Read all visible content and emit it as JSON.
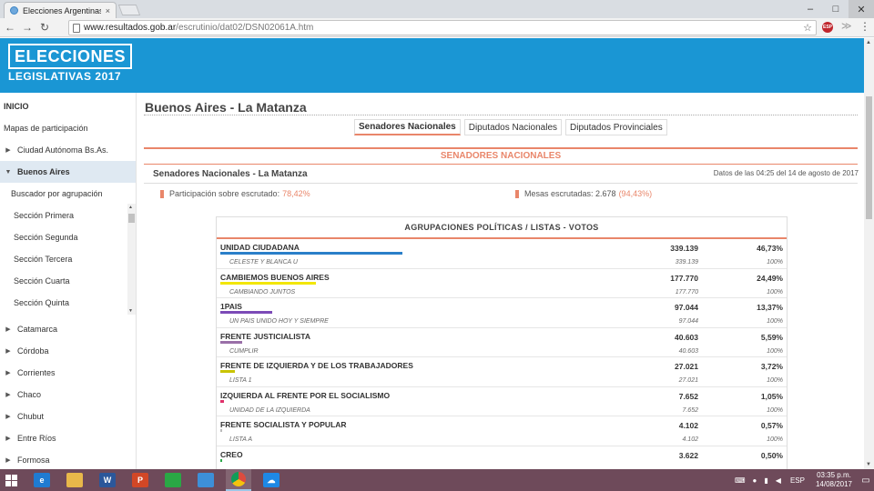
{
  "browser": {
    "tab_title": "Elecciones Argentinas de",
    "tab_close": "×",
    "url_host": "www.resultados.gob.ar",
    "url_path": "/escrutinio/dat02/DSN02061A.htm",
    "abp_label": "ESP",
    "minimize": "–",
    "maximize": "□",
    "close": "✕",
    "back": "←",
    "forward": "→",
    "reload": "↻",
    "star": "☆",
    "menu": "⋮",
    "ext2": "≫"
  },
  "banner": {
    "logo_line1": "ELECCIONES",
    "logo_line2": "LEGISLATIVAS 2017",
    "color": "#1a96d4"
  },
  "sidebar": {
    "items": [
      {
        "label": "INICIO"
      },
      {
        "label": "Mapas de participación"
      },
      {
        "label": "Ciudad Autónoma Bs.As."
      },
      {
        "label": "Buenos Aires"
      },
      {
        "label": "Buscador por agrupación"
      },
      {
        "label": "Sección Primera"
      },
      {
        "label": "Sección Segunda"
      },
      {
        "label": "Sección Tercera"
      },
      {
        "label": "Sección Cuarta"
      },
      {
        "label": "Sección Quinta"
      },
      {
        "label": "Catamarca"
      },
      {
        "label": "Córdoba"
      },
      {
        "label": "Corrientes"
      },
      {
        "label": "Chaco"
      },
      {
        "label": "Chubut"
      },
      {
        "label": "Entre Ríos"
      },
      {
        "label": "Formosa"
      }
    ],
    "caret_right": "▶",
    "caret_down": "▼"
  },
  "main": {
    "page_title": "Buenos Aires - La Matanza",
    "tabs": [
      {
        "label": "Senadores Nacionales"
      },
      {
        "label": "Diputados Nacionales"
      },
      {
        "label": "Diputados Provinciales"
      }
    ],
    "section_title": "SENADORES NACIONALES",
    "district": "Senadores Nacionales - La Matanza",
    "timestamp": "Datos de las 04:25 del 14 de agosto de 2017",
    "participation_label": "Participación sobre escrutado:",
    "participation_value": "78,42%",
    "tables_label": "Mesas escrutadas: 2.678",
    "tables_value": "(94,43%)",
    "accent": "#e9866a"
  },
  "results": {
    "header": "AGRUPACIONES POLÍTICAS / LISTAS - VOTOS",
    "parties": [
      {
        "name": "UNIDAD CIUDADANA",
        "votes": "339.139",
        "pct": "46,73%",
        "share": 46.73,
        "color": "#2a7fc9",
        "list": "CELESTE Y BLANCA U",
        "list_votes": "339.139",
        "list_pct": "100%"
      },
      {
        "name": "CAMBIEMOS BUENOS AIRES",
        "votes": "177.770",
        "pct": "24,49%",
        "share": 24.49,
        "color": "#f2e600",
        "list": "CAMBIANDO JUNTOS",
        "list_votes": "177.770",
        "list_pct": "100%"
      },
      {
        "name": "1PAIS",
        "votes": "97.044",
        "pct": "13,37%",
        "share": 13.37,
        "color": "#7c4bb7",
        "list": "UN PAIS UNIDO HOY Y SIEMPRE",
        "list_votes": "97.044",
        "list_pct": "100%"
      },
      {
        "name": "FRENTE JUSTICIALISTA",
        "votes": "40.603",
        "pct": "5,59%",
        "share": 5.59,
        "color": "#9a6fa8",
        "list": "CUMPLIR",
        "list_votes": "40.603",
        "list_pct": "100%"
      },
      {
        "name": "FRENTE DE IZQUIERDA Y DE LOS TRABAJADORES",
        "votes": "27.021",
        "pct": "3,72%",
        "share": 3.72,
        "color": "#c9c400",
        "list": "LISTA 1",
        "list_votes": "27.021",
        "list_pct": "100%"
      },
      {
        "name": "IZQUIERDA AL FRENTE POR EL SOCIALISMO",
        "votes": "7.652",
        "pct": "1,05%",
        "share": 1.05,
        "color": "#e0306a",
        "list": "UNIDAD DE LA IZQUIERDA",
        "list_votes": "7.652",
        "list_pct": "100%"
      },
      {
        "name": "FRENTE SOCIALISTA Y POPULAR",
        "votes": "4.102",
        "pct": "0,57%",
        "share": 0.57,
        "color": "#bbbbbb",
        "list": "LISTA A",
        "list_votes": "4.102",
        "list_pct": "100%"
      },
      {
        "name": "CREO",
        "votes": "3.622",
        "pct": "0,50%",
        "share": 0.5,
        "color": "#2da84a",
        "list": "",
        "list_votes": "",
        "list_pct": ""
      }
    ]
  },
  "taskbar": {
    "apps": [
      {
        "icon": "ie-icon",
        "glyph": "e",
        "color": "#1f7bd1"
      },
      {
        "icon": "file-explorer-icon",
        "glyph": "",
        "color": "#e8b84a"
      },
      {
        "icon": "word-icon",
        "glyph": "W",
        "color": "#2b579a"
      },
      {
        "icon": "powerpoint-icon",
        "glyph": "P",
        "color": "#d24726"
      },
      {
        "icon": "store-icon",
        "glyph": "",
        "color": "#2aa845"
      },
      {
        "icon": "app-blue-icon",
        "glyph": "",
        "color": "#3d8fd8"
      },
      {
        "icon": "chrome-icon",
        "glyph": "",
        "color": "#dd4b3e"
      },
      {
        "icon": "onedrive-icon",
        "glyph": "☁",
        "color": "#1e88e5"
      }
    ],
    "lang": "ESP",
    "time": "03:35 p.m.",
    "date": "14/08/2017"
  }
}
